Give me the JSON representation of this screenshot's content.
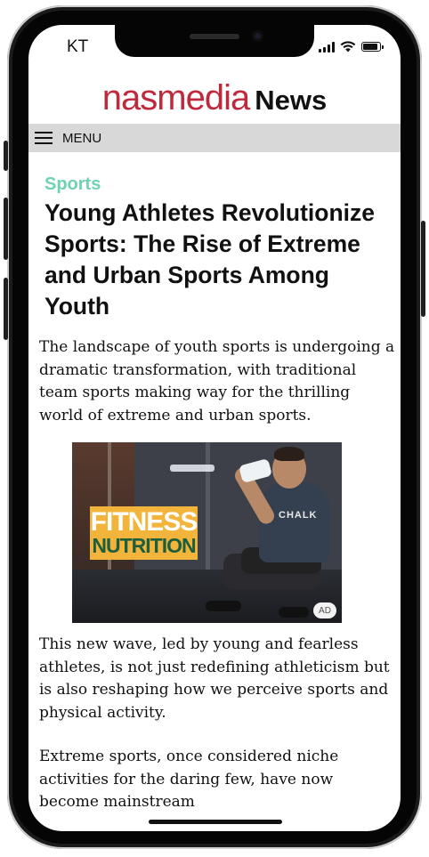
{
  "status_bar": {
    "carrier": "KT"
  },
  "header": {
    "brand": "nasmedia",
    "section": "News",
    "brand_color": "#c0283c"
  },
  "menu": {
    "label": "MENU",
    "icon": "hamburger-menu-icon"
  },
  "article": {
    "category": "Sports",
    "category_color": "#6fd3b0",
    "headline": "Young Athletes Revolutionize Sports: The Rise of Extreme and Urban Sports Among Youth",
    "paragraphs": [
      "The landscape of youth sports is undergoing a dramatic transformation, with traditional team sports making way for the thrilling world of extreme and urban sports.",
      "This new wave, led by young and fearless athletes, is not just redefining athleticism but is also reshaping how we perceive sports and physical activity.",
      "Extreme sports, once considered niche activities for the daring few, have now become mainstream"
    ]
  },
  "ad": {
    "line1": "FITNESS",
    "line2": "NUTRITION",
    "shirt_text": "CHALK",
    "badge": "AD"
  }
}
